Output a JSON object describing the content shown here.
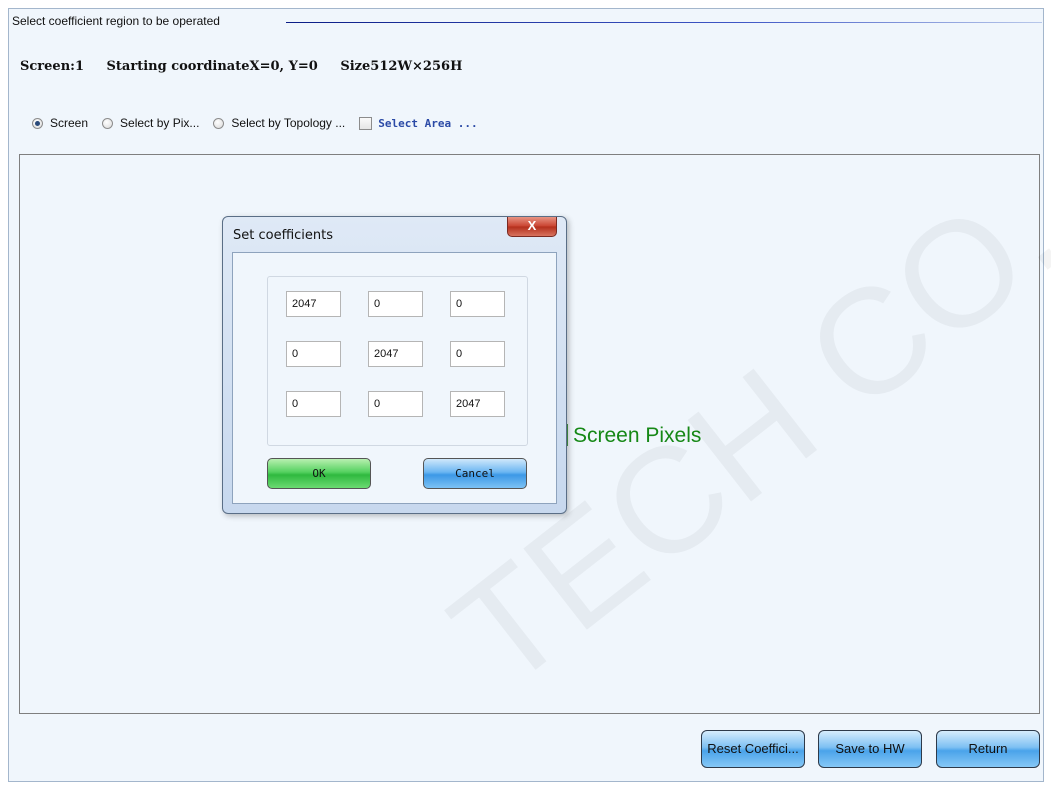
{
  "group": {
    "legend": "Select coefficient region to be operated"
  },
  "screen_info": {
    "screen": "Screen:1",
    "start": "Starting coordinateX=0, Y=0",
    "size": "Size512W×256H"
  },
  "options": {
    "screen_label": "Screen",
    "pixel_label": "Select by Pix...",
    "topology_label": "Select by Topology ...",
    "area_label": "Select Area ...",
    "selected": "Screen",
    "select_area_checked": false
  },
  "canvas": {
    "label": "Screen Pixels",
    "label_color": "#168816",
    "watermark": "TECH CO., LTD"
  },
  "dialog": {
    "title": "Set coefficients",
    "close_glyph": "X",
    "matrix": [
      [
        "2047",
        "0",
        "0"
      ],
      [
        "0",
        "2047",
        "0"
      ],
      [
        "0",
        "0",
        "2047"
      ]
    ],
    "ok_label": "OK",
    "cancel_label": "Cancel"
  },
  "buttons": {
    "reset_label": "Reset Coeffici...",
    "save_label": "Save to HW",
    "return_label": "Return"
  }
}
